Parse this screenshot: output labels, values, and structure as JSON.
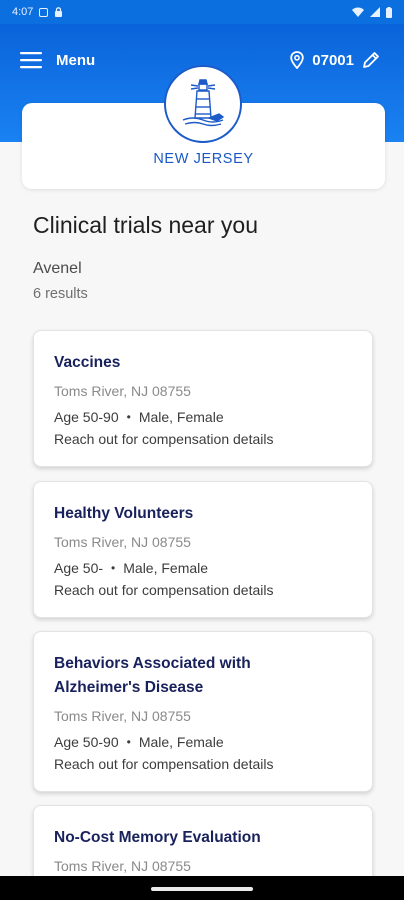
{
  "status_bar": {
    "time": "4:07"
  },
  "header": {
    "menu_label": "Menu",
    "zip": "07001",
    "colors": {
      "primary": "#0b6fe0",
      "state_text": "#1b58c3",
      "title_text": "#19215c"
    }
  },
  "state": {
    "name": "NEW JERSEY",
    "logo_icon": "lighthouse-icon"
  },
  "page": {
    "title": "Clinical trials near you",
    "city": "Avenel",
    "results": "6 results"
  },
  "trials": [
    {
      "title_lines": [
        "Vaccines"
      ],
      "location": "Toms River, NJ 08755",
      "age": "Age 50-90",
      "gender": "Male, Female",
      "compensation": "Reach out for compensation details"
    },
    {
      "title_lines": [
        "Healthy Volunteers"
      ],
      "location": "Toms River, NJ 08755",
      "age": "Age 50-",
      "gender": "Male, Female",
      "compensation": "Reach out for compensation details"
    },
    {
      "title_lines": [
        "Behaviors Associated with",
        "Alzheimer's Disease"
      ],
      "location": "Toms River, NJ 08755",
      "age": "Age 50-90",
      "gender": "Male, Female",
      "compensation": "Reach out for compensation details"
    },
    {
      "title_lines": [
        "No-Cost Memory Evaluation"
      ],
      "location": "Toms River, NJ 08755"
    }
  ]
}
